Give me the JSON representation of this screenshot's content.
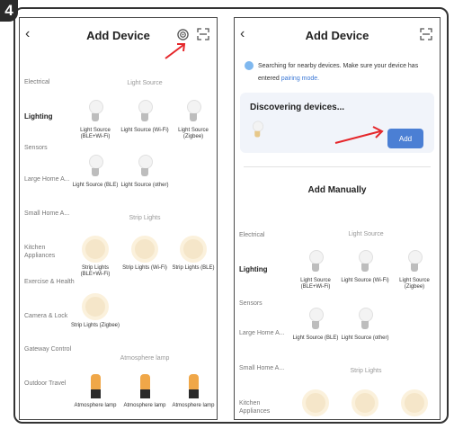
{
  "step": "4",
  "arrow_color": "#e5262a",
  "left": {
    "title": "Add Device",
    "sidebar": [
      "Electrical",
      "Lighting",
      "Sensors",
      "Large Home A...",
      "Small Home A...",
      "Kitchen Appliances",
      "Exercise & Health",
      "Camera & Lock",
      "Gateway Control",
      "Outdoor Travel"
    ],
    "active_category": "Lighting",
    "sections": [
      {
        "title": "Light Source",
        "items": [
          "Light Source (BLE+Wi-Fi)",
          "Light Source (Wi-Fi)",
          "Light Source (Zigbee)",
          "Light Source (BLE)",
          "Light Source (other)"
        ]
      },
      {
        "title": "Strip Lights",
        "items": [
          "Strip Lights (BLE+Wi-Fi)",
          "Strip Lights (Wi-Fi)",
          "Strip Lights (BLE)",
          "Strip Lights (Zigbee)"
        ]
      },
      {
        "title": "Atmosphere lamp",
        "items": [
          "Atmosphere lamp",
          "Atmosphere lamp",
          "Atmosphere lamp"
        ]
      }
    ],
    "icons": {
      "back": "back-chevron-icon",
      "scan": "scan-qr-icon",
      "auto_scan": "wifi-scan-target-icon"
    }
  },
  "right": {
    "title": "Add Device",
    "searching_text": "Searching for nearby devices. Make sure your device has entered",
    "searching_link": "pairing mode.",
    "discovering": "Discovering devices...",
    "add_button": "Add",
    "add_manually": "Add Manually",
    "sidebar": [
      "Electrical",
      "Lighting",
      "Sensors",
      "Large Home A...",
      "Small Home A...",
      "Kitchen Appliances"
    ],
    "active_category": "Lighting",
    "sections": [
      {
        "title": "Light Source",
        "items": [
          "Light Source (BLE+Wi-Fi)",
          "Light Source (Wi-Fi)",
          "Light Source (Zigbee)",
          "Light Source (BLE)",
          "Light Source (other)"
        ]
      },
      {
        "title": "Strip Lights",
        "items": []
      }
    ]
  }
}
